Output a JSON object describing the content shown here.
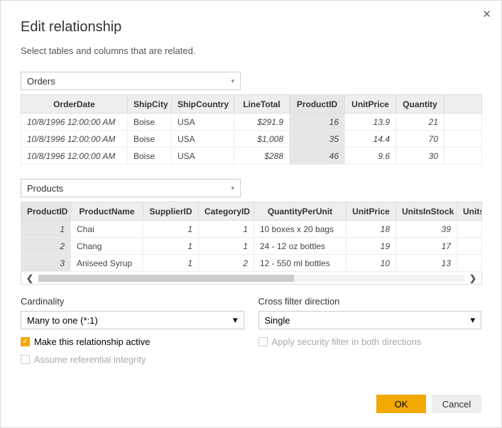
{
  "dialog": {
    "title": "Edit relationship",
    "subtitle": "Select tables and columns that are related.",
    "close": "✕"
  },
  "table1": {
    "selected": "Orders",
    "headers": [
      "OrderDate",
      "ShipCity",
      "ShipCountry",
      "LineTotal",
      "ProductID",
      "UnitPrice",
      "Quantity"
    ],
    "rows": [
      {
        "OrderDate": "10/8/1996 12:00:00 AM",
        "ShipCity": "Boise",
        "ShipCountry": "USA",
        "LineTotal": "$291.9",
        "ProductID": "16",
        "UnitPrice": "13.9",
        "Quantity": "21"
      },
      {
        "OrderDate": "10/8/1996 12:00:00 AM",
        "ShipCity": "Boise",
        "ShipCountry": "USA",
        "LineTotal": "$1,008",
        "ProductID": "35",
        "UnitPrice": "14.4",
        "Quantity": "70"
      },
      {
        "OrderDate": "10/8/1996 12:00:00 AM",
        "ShipCity": "Boise",
        "ShipCountry": "USA",
        "LineTotal": "$288",
        "ProductID": "46",
        "UnitPrice": "9.6",
        "Quantity": "30"
      }
    ]
  },
  "table2": {
    "selected": "Products",
    "headers": [
      "ProductID",
      "ProductName",
      "SupplierID",
      "CategoryID",
      "QuantityPerUnit",
      "UnitPrice",
      "UnitsInStock",
      "UnitsOnOrder"
    ],
    "rows": [
      {
        "ProductID": "1",
        "ProductName": "Chai",
        "SupplierID": "1",
        "CategoryID": "1",
        "QuantityPerUnit": "10 boxes x 20 bags",
        "UnitPrice": "18",
        "UnitsInStock": "39"
      },
      {
        "ProductID": "2",
        "ProductName": "Chang",
        "SupplierID": "1",
        "CategoryID": "1",
        "QuantityPerUnit": "24 - 12 oz bottles",
        "UnitPrice": "19",
        "UnitsInStock": "17"
      },
      {
        "ProductID": "3",
        "ProductName": "Aniseed Syrup",
        "SupplierID": "1",
        "CategoryID": "2",
        "QuantityPerUnit": "12 - 550 ml bottles",
        "UnitPrice": "10",
        "UnitsInStock": "13"
      }
    ]
  },
  "options": {
    "cardinality_label": "Cardinality",
    "cardinality_value": "Many to one (*:1)",
    "crossfilter_label": "Cross filter direction",
    "crossfilter_value": "Single",
    "active_label": "Make this relationship active",
    "security_label": "Apply security filter in both directions",
    "integrity_label": "Assume referential integrity"
  },
  "buttons": {
    "ok": "OK",
    "cancel": "Cancel"
  },
  "glyph": {
    "chev": "▾",
    "check": "✓",
    "left": "❮",
    "right": "❯"
  }
}
